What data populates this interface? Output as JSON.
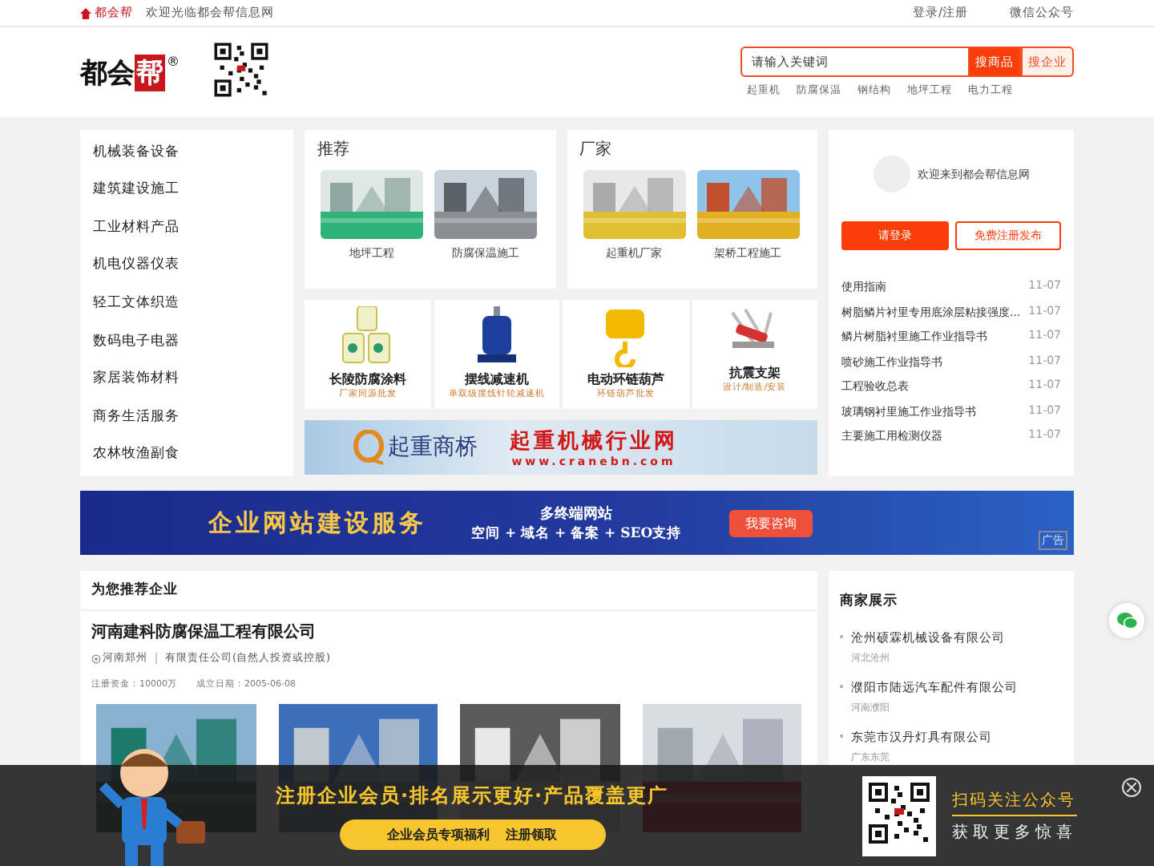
{
  "top_bar": {
    "brand": "都会帮",
    "welcome": "欢迎光临都会帮信息网",
    "links": [
      "登录/注册",
      "微信公众号"
    ]
  },
  "header": {
    "logo": {
      "plain": "都会",
      "boxed": "帮",
      "registered": "®"
    },
    "search": {
      "placeholder": "请输入关键词",
      "buttons": [
        {
          "label": "搜商品",
          "selected": true
        },
        {
          "label": "搜企业",
          "selected": false
        }
      ]
    },
    "hot_words": [
      "起重机",
      "防腐保温",
      "钢结构",
      "地坪工程",
      "电力工程"
    ]
  },
  "categories": [
    "机械装备设备",
    "建筑建设施工",
    "工业材料产品",
    "机电仪器仪表",
    "轻工文体织造",
    "数码电子电器",
    "家居装饰材料",
    "商务生活服务",
    "农林牧渔副食"
  ],
  "showcases": [
    {
      "title": "推荐",
      "items": [
        {
          "label": "地坪工程",
          "kind": "picture"
        },
        {
          "label": "防腐保温施工",
          "kind": "picture"
        }
      ]
    },
    {
      "title": "厂家",
      "items": [
        {
          "label": "起重机厂家",
          "kind": "picture"
        },
        {
          "label": "架桥工程施工",
          "kind": "picture"
        }
      ]
    }
  ],
  "products": [
    {
      "name": "长陵防腐涂料",
      "subtitle": "厂家同源批发"
    },
    {
      "name": "摆线减速机",
      "subtitle": "单双级摆线针轮减速机"
    },
    {
      "name": "电动环链葫芦",
      "subtitle": "环链葫芦批发"
    },
    {
      "name": "抗震支架",
      "subtitle": "设计/制造/安装"
    }
  ],
  "crane_banner": {
    "left": "起重商桥",
    "right": "起重机械行业网",
    "url": "www.cranebn.com"
  },
  "user_panel": {
    "welcome": "欢迎来到都会帮信息网",
    "login": "请登录",
    "register": "免费注册发布",
    "news": [
      {
        "title": "使用指南",
        "date": "11-07"
      },
      {
        "title": "树脂鳞片衬里专用底涂层粘接强度...",
        "date": "11-07"
      },
      {
        "title": "鳞片树脂衬里施工作业指导书",
        "date": "11-07"
      },
      {
        "title": "喷砂施工作业指导书",
        "date": "11-07"
      },
      {
        "title": "工程验收总表",
        "date": "11-07"
      },
      {
        "title": "玻璃钢衬里施工作业指导书",
        "date": "11-07"
      },
      {
        "title": "主要施工用检测仪器",
        "date": "11-07"
      }
    ]
  },
  "service_banner": {
    "title": "企业网站建设服务",
    "line_1": "多终端网站",
    "line_2": "空间 + 域名 + 备案 + SEO支持",
    "button": "我要咨询",
    "tag": "广告"
  },
  "recommended": {
    "title": "为您推荐企业",
    "company": {
      "name": "河南建科防腐保温工程有限公司",
      "location": "河南郑州",
      "type": "有限责任公司(自然人投资或控股)",
      "capital": "注册资金：10000万",
      "founded": "成立日期：2005-06-08"
    }
  },
  "merchants": {
    "title": "商家展示",
    "items": [
      {
        "name": "沧州硕霖机械设备有限公司",
        "location": "河北沧州"
      },
      {
        "name": "濮阳市陆远汽车配件有限公司",
        "location": "河南濮阳"
      },
      {
        "name": "东莞市汉丹灯具有限公司",
        "location": "广东东莞"
      }
    ]
  },
  "promo": {
    "headline": "注册企业会员·排名展示更好·产品覆盖更广",
    "button": [
      "企业会员专项福利",
      "注册领取"
    ],
    "qr_title": "扫码关注公众号",
    "qr_subtitle": "获取更多惊喜"
  }
}
